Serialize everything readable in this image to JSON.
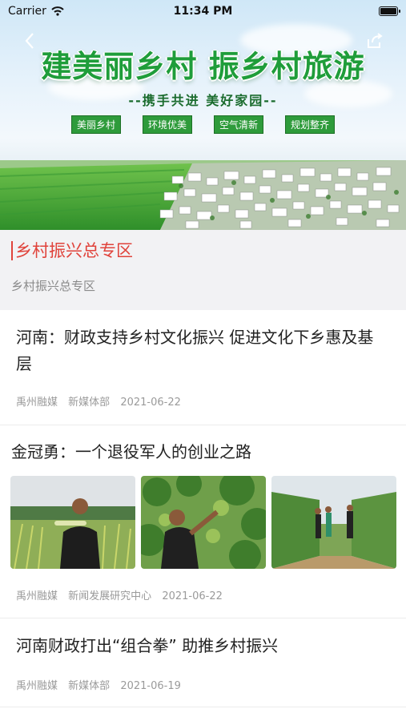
{
  "status": {
    "carrier": "Carrier",
    "time": "11:34 PM"
  },
  "banner": {
    "title": "建美丽乡村  振乡村旅游",
    "subtitle": "--携手共进  美好家园--",
    "tags": [
      "美丽乡村",
      "环境优美",
      "空气清新",
      "规划整齐"
    ]
  },
  "zone": {
    "title": "乡村振兴总专区",
    "subtitle": "乡村振兴总专区"
  },
  "articles": [
    {
      "title": "河南：财政支持乡村文化振兴 促进文化下乡惠及基层",
      "source": "禹州融媒",
      "dept": "新媒体部",
      "date": "2021-06-22"
    },
    {
      "title": "金冠勇：一个退役军人的创业之路",
      "source": "禹州融媒",
      "dept": "新闻发展研究中心",
      "date": "2021-06-22"
    },
    {
      "title": "河南财政打出“组合拳” 助推乡村振兴",
      "source": "禹州融媒",
      "dept": "新媒体部",
      "date": "2021-06-19"
    }
  ]
}
